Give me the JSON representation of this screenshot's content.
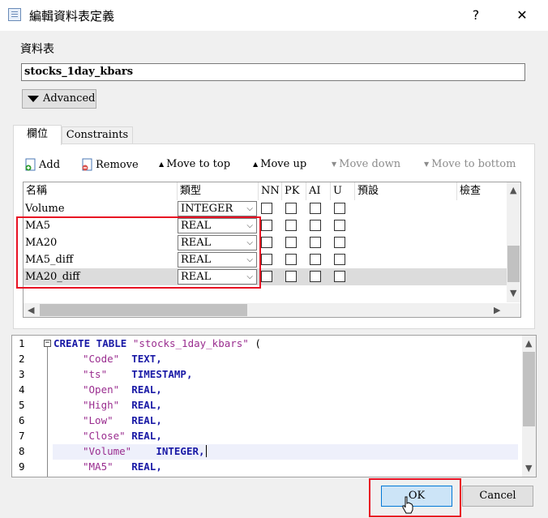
{
  "window": {
    "title": "編輯資料表定義",
    "help_label": "?",
    "close_label": "✕"
  },
  "table_group": {
    "label": "資料表",
    "table_name": "stocks_1day_kbars",
    "advanced_label": "Advanced"
  },
  "tabs": [
    {
      "label": "欄位"
    },
    {
      "label": "Constraints"
    }
  ],
  "toolbar": {
    "add": "Add",
    "remove": "Remove",
    "move_top": "Move to top",
    "move_up": "Move up",
    "move_down": "Move down",
    "move_bottom": "Move to bottom"
  },
  "grid": {
    "headers": {
      "name": "名稱",
      "type": "類型",
      "nn": "NN",
      "pk": "PK",
      "ai": "AI",
      "u": "U",
      "default": "預設",
      "check": "檢查"
    },
    "rows": [
      {
        "name": "Volume",
        "type": "INTEGER"
      },
      {
        "name": "MA5",
        "type": "REAL"
      },
      {
        "name": "MA20",
        "type": "REAL"
      },
      {
        "name": "MA5_diff",
        "type": "REAL"
      },
      {
        "name": "MA20_diff",
        "type": "REAL"
      }
    ]
  },
  "sql": {
    "lines": [
      {
        "num": "1",
        "t1": "CREATE TABLE ",
        "t2": "\"stocks_1day_kbars\"",
        "t3": " ("
      },
      {
        "num": "2",
        "t1": "\"Code\"",
        "t2": "  TEXT,"
      },
      {
        "num": "3",
        "t1": "\"ts\"",
        "t2": "    TIMESTAMP,"
      },
      {
        "num": "4",
        "t1": "\"Open\"",
        "t2": "  REAL,"
      },
      {
        "num": "5",
        "t1": "\"High\"",
        "t2": "  REAL,"
      },
      {
        "num": "6",
        "t1": "\"Low\"",
        "t2": "   REAL,"
      },
      {
        "num": "7",
        "t1": "\"Close\"",
        "t2": " REAL,"
      },
      {
        "num": "8",
        "t1": "\"Volume\"",
        "t2": "    INTEGER,"
      },
      {
        "num": "9",
        "t1": "\"MA5\"",
        "t2": "   REAL,"
      }
    ]
  },
  "buttons": {
    "ok": "OK",
    "cancel": "Cancel"
  },
  "colors": {
    "highlight": "#e81123",
    "keyword": "#1a1aa6",
    "string": "#9a2d8f"
  }
}
